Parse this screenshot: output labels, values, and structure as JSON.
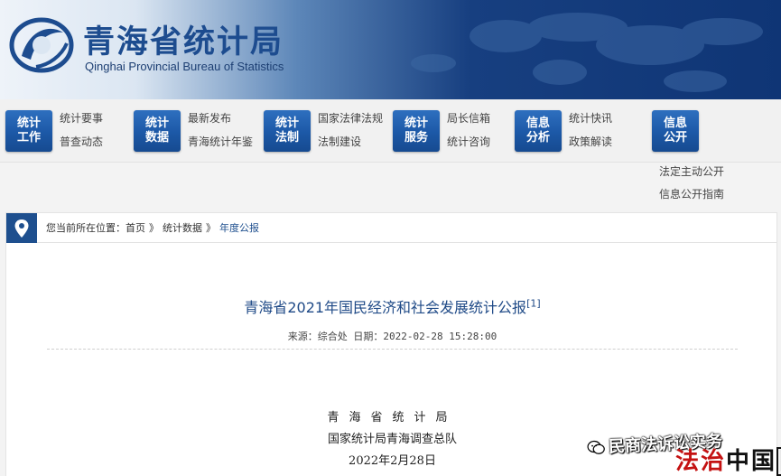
{
  "header": {
    "title": "青海省统计局",
    "subtitle": "Qinghai Provincial Bureau of Statistics"
  },
  "nav": [
    {
      "badge": [
        "统计",
        "工作"
      ],
      "links": [
        "统计要事",
        "普查动态"
      ]
    },
    {
      "badge": [
        "统计",
        "数据"
      ],
      "links": [
        "最新发布",
        "青海统计年鉴"
      ]
    },
    {
      "badge": [
        "统计",
        "法制"
      ],
      "links": [
        "国家法律法规",
        "法制建设"
      ]
    },
    {
      "badge": [
        "统计",
        "服务"
      ],
      "links": [
        "局长信箱",
        "统计咨询"
      ]
    },
    {
      "badge": [
        "信息",
        "分析"
      ],
      "links": [
        "统计快讯",
        "政策解读"
      ]
    },
    {
      "badge": [
        "信息",
        "公开"
      ],
      "links": [
        "法定主动公开",
        "信息公开指南"
      ]
    }
  ],
  "breadcrumb": {
    "prefix": "您当前所在位置：",
    "items": [
      "首页",
      "统计数据",
      "年度公报"
    ],
    "separator": "》"
  },
  "article": {
    "title": "青海省2021年国民经济和社会发展统计公报",
    "footnote": "[1]",
    "meta": "来源：综合处 日期：2022-02-28 15:28:00",
    "org1": "青海省统计局",
    "org2": "国家统计局青海调查总队",
    "date": "2022年2月28日"
  },
  "watermark": {
    "line1": "民商法诉讼实务",
    "line2": [
      "法",
      "治",
      "中",
      "国",
      "网"
    ]
  },
  "colors": {
    "brand_blue": "#1e4f8e",
    "badge_blue": "#1c58a6",
    "title_blue": "#1f4a87",
    "watermark_red": "#c41212"
  },
  "icons": {
    "logo": "bureau-logo-icon",
    "breadcrumb": "location-pin-icon",
    "watermark": "wechat-icon"
  }
}
